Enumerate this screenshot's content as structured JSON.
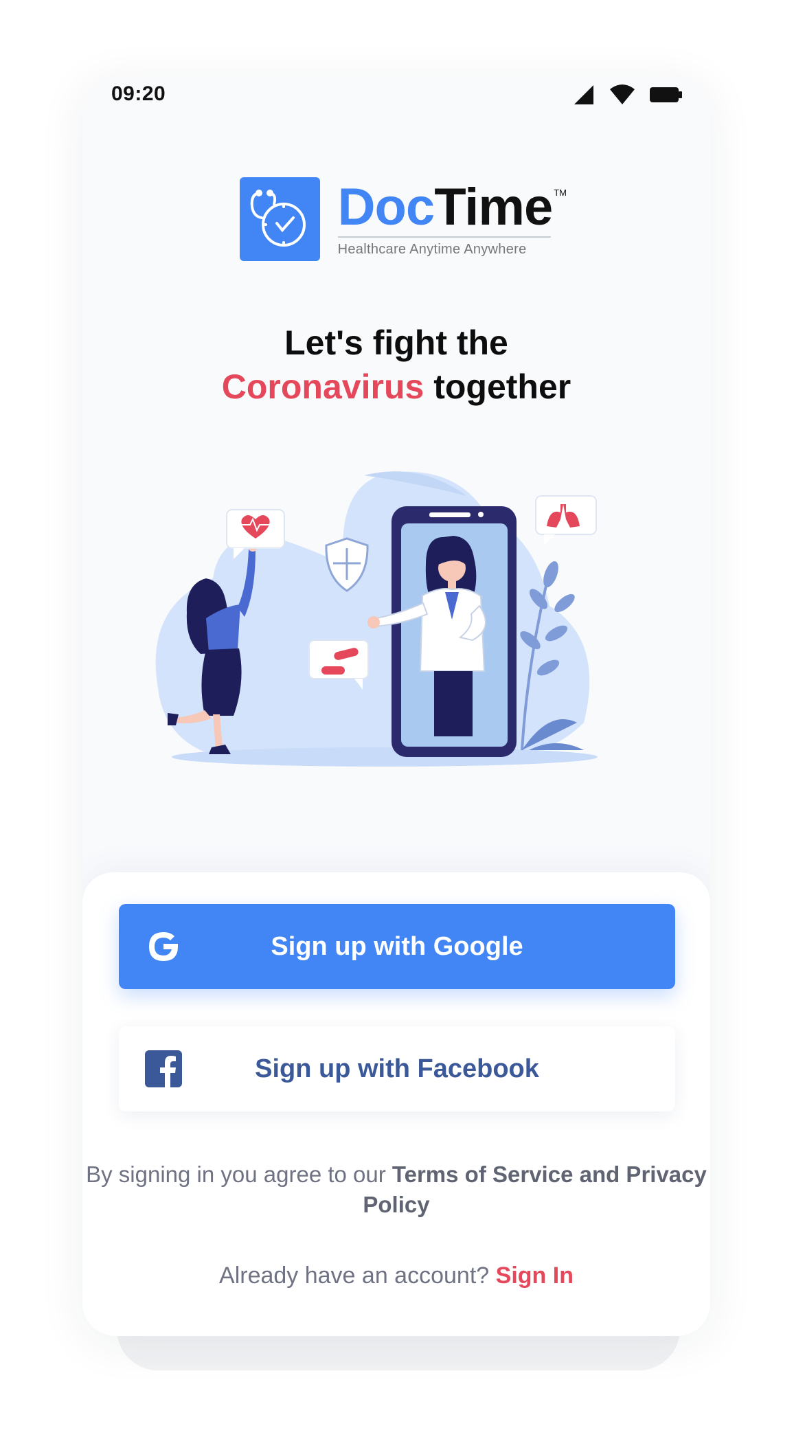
{
  "status_bar": {
    "time": "09:20"
  },
  "logo": {
    "brand_part1": "Doc",
    "brand_part2": "Time",
    "trademark": "TM",
    "tagline": "Healthcare Anytime Anywhere"
  },
  "headline": {
    "line1": "Let's fight the",
    "accent": "Coronavirus",
    "line2_rest": "together"
  },
  "actions": {
    "google_label": "Sign up with Google",
    "facebook_label": "Sign up with Facebook"
  },
  "terms": {
    "prefix": "By signing in you agree to our",
    "link": "Terms of Service and Privacy Policy"
  },
  "signin": {
    "prompt": "Already have an account?",
    "link": "Sign In"
  },
  "colors": {
    "brand_blue": "#4285f4",
    "accent_red": "#e5485b",
    "facebook_blue": "#3b5998",
    "text_gray": "#6e7282"
  }
}
